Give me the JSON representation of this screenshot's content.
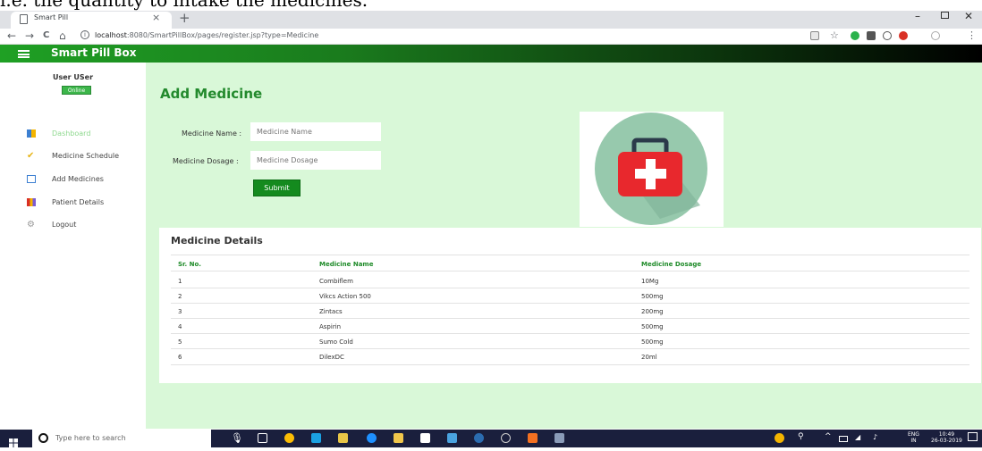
{
  "doc_caption": "i.e. the quantity to intake the medicines.",
  "browser": {
    "tab_title": "Smart Pill",
    "tab_close": "×",
    "new_tab": "+",
    "url_host": "localhost",
    "url_rest": ":8080/SmartPillBox/pages/register.jsp?type=Medicine",
    "win_min": "–",
    "win_close": "✕",
    "back": "←",
    "forward": "→",
    "reload": "C",
    "home": "⌂"
  },
  "app": {
    "title": "Smart Pill Box"
  },
  "sidebar": {
    "user_name": "User USer",
    "status": "Online",
    "items": [
      {
        "label": "Dashboard",
        "color": "#8fd98f"
      },
      {
        "label": "Medicine Schedule",
        "color": "#444"
      },
      {
        "label": "Add Medicines",
        "color": "#444"
      },
      {
        "label": "Patient Details",
        "color": "#444"
      },
      {
        "label": "Logout",
        "color": "#444"
      }
    ]
  },
  "form": {
    "title": "Add Medicine",
    "name_label": "Medicine Name :",
    "name_placeholder": "Medicine Name",
    "dosage_label": "Medicine Dosage :",
    "dosage_placeholder": "Medicine Dosage",
    "submit": "Submit"
  },
  "details": {
    "title": "Medicine Details",
    "headers": [
      "Sr. No.",
      "Medicine Name",
      "Medicine Dosage"
    ],
    "rows": [
      [
        "1",
        "Combiflem",
        "10Mg"
      ],
      [
        "2",
        "Vikcs Action 500",
        "500mg"
      ],
      [
        "3",
        "Zintacs",
        "200mg"
      ],
      [
        "4",
        "Aspirin",
        "500mg"
      ],
      [
        "5",
        "Sumo Cold",
        "500mg"
      ],
      [
        "6",
        "DilexDC",
        "20ml"
      ]
    ]
  },
  "taskbar": {
    "search_placeholder": "Type here to search",
    "lang_top": "ENG",
    "lang_bottom": "IN",
    "time": "10:49",
    "date": "26-03-2019"
  },
  "colors": {
    "brand_green": "#1fa024",
    "content_bg": "#d9f8d8",
    "header_text_green": "#1d8a27"
  }
}
